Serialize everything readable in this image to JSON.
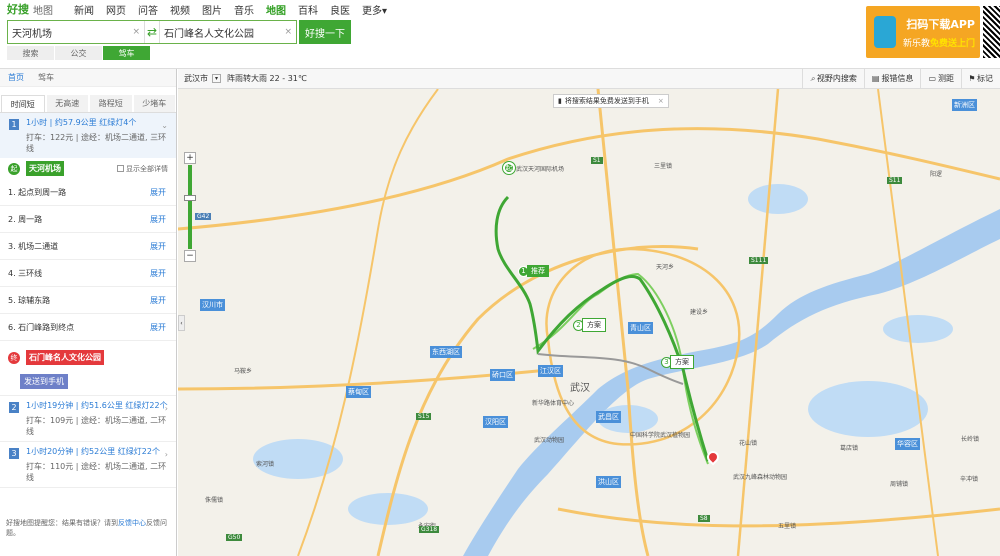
{
  "header": {
    "logo": "好搜",
    "logo_sub": "地图",
    "nav": [
      "新闻",
      "网页",
      "问答",
      "视频",
      "图片",
      "音乐",
      "地图",
      "百科",
      "良医",
      "更多"
    ],
    "nav_active_index": 6,
    "more_caret": "▾"
  },
  "search": {
    "from": "天河机场",
    "to": "石门峰名人文化公园",
    "clear": "×",
    "submit": "好搜一下",
    "modes": [
      "搜索",
      "公交",
      "驾车"
    ],
    "mode_active_index": 2
  },
  "promo": {
    "line1": "扫码下载APP",
    "line2_prefix": "新乐教",
    "line2_highlight": "免费送上门"
  },
  "sidebar": {
    "crumbs": [
      "首页",
      "驾车"
    ],
    "strategies": [
      "时间短",
      "无高速",
      "路程短",
      "少堵车"
    ],
    "strategy_active_index": 0,
    "routes": [
      {
        "num": "1",
        "summary": "1小时 | 约57.9公里 红绿灯4个",
        "detail": "打车：122元 | 途经：机场二通道, 三环线"
      },
      {
        "num": "2",
        "summary": "1小时19分钟 | 约51.6公里 红绿灯22个",
        "detail": "打车：109元 | 途经：机场二通道, 二环线"
      },
      {
        "num": "3",
        "summary": "1小时20分钟 | 约52公里 红绿灯22个",
        "detail": "打车：110元 | 途经：机场二通道, 二环线"
      }
    ],
    "start_badge": "起",
    "start_name": "天河机场",
    "show_all": "显示全部详情",
    "steps": [
      "1. 起点到周一路",
      "2. 周一路",
      "3. 机场二通道",
      "4. 三环线",
      "5. 琼辅东路",
      "6. 石门峰路到终点"
    ],
    "expand": "展开",
    "end_badge": "终",
    "end_name": "石门峰名人文化公园",
    "send_phone": "发送到手机",
    "feedback_prefix": "好搜地图提醒您：结果有错误？请到",
    "feedback_link": "反馈中心",
    "feedback_suffix": "反馈问题。"
  },
  "mapbar": {
    "city": "武汉市",
    "weather": "阵雨转大雨 22 - 31℃",
    "tools": [
      "视野内搜索",
      "报错信息",
      "测距",
      "标记"
    ]
  },
  "map": {
    "tip": "将搜索结果免费发送到手机",
    "tip_close": "×",
    "zoom_in": "+",
    "zoom_out": "−",
    "collapse": "‹",
    "start_pin": "起",
    "markers": [
      {
        "num": "1",
        "label": "推荐"
      },
      {
        "num": "2",
        "label": "方案"
      },
      {
        "num": "3",
        "label": "方案"
      }
    ],
    "districts": [
      "新洲区",
      "汉川市",
      "东西湖区",
      "硚口区",
      "江汉区",
      "青山区",
      "汉阳区",
      "蔡甸区",
      "武昌区",
      "洪山区",
      "华容区"
    ],
    "places": [
      "武汉天河国际机场",
      "三里镇",
      "天河乡",
      "建设乡",
      "武汉",
      "新华路体育中心",
      "武汉动物园",
      "中国科学院武汉植物园",
      "武汉九峰森林动物园",
      "葛店镇",
      "阳逻",
      "花山镇",
      "长岭镇",
      "周铺镇",
      "马鞍乡",
      "索河镇",
      "侏儒镇",
      "永安街",
      "五里镇",
      "辛冲镇"
    ],
    "road_tags": [
      "S1",
      "S111",
      "S11",
      "G42",
      "S15",
      "G318",
      "G50",
      "S8"
    ],
    "colors": {
      "route_main": "#3fa734",
      "route_alt": "#7dcf60",
      "water": "#a8cbef",
      "road": "#f6c56a"
    }
  }
}
